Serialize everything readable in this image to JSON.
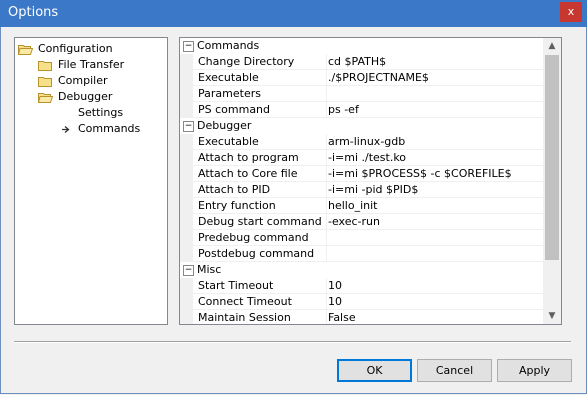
{
  "window": {
    "title": "Options",
    "close_label": "x"
  },
  "tree": {
    "items": [
      {
        "label": "Configuration",
        "icon": "folder-open-icon"
      },
      {
        "label": "File Transfer",
        "icon": "folder-icon"
      },
      {
        "label": "Compiler",
        "icon": "folder-icon"
      },
      {
        "label": "Debugger",
        "icon": "folder-open-icon"
      },
      {
        "label": "Settings",
        "icon": ""
      },
      {
        "label": "Commands",
        "icon": "arrow-right-icon"
      }
    ]
  },
  "properties": {
    "categories": [
      {
        "label": "Commands",
        "collapse_glyph": "−",
        "props": [
          {
            "name": "Change Directory",
            "value": "cd $PATH$"
          },
          {
            "name": "Executable",
            "value": "./$PROJECTNAME$"
          },
          {
            "name": "Parameters",
            "value": ""
          },
          {
            "name": "PS command",
            "value": "ps -ef"
          }
        ]
      },
      {
        "label": "Debugger",
        "collapse_glyph": "−",
        "props": [
          {
            "name": "Executable",
            "value": "arm-linux-gdb"
          },
          {
            "name": "Attach to program",
            "value": "-i=mi ./test.ko"
          },
          {
            "name": "Attach to Core file",
            "value": "-i=mi $PROCESS$ -c $COREFILE$"
          },
          {
            "name": "Attach to PID",
            "value": "-i=mi -pid $PID$"
          },
          {
            "name": "Entry function",
            "value": "hello_init",
            "editing": true
          },
          {
            "name": "Debug start command",
            "value": "-exec-run"
          },
          {
            "name": "Predebug command",
            "value": ""
          },
          {
            "name": "Postdebug command",
            "value": ""
          }
        ]
      },
      {
        "label": "Misc",
        "collapse_glyph": "−",
        "props": [
          {
            "name": "Start Timeout",
            "value": "10"
          },
          {
            "name": "Connect Timeout",
            "value": "10"
          },
          {
            "name": "Maintain Session",
            "value": "False"
          }
        ]
      }
    ],
    "scroll_up_glyph": "▲",
    "scroll_down_glyph": "▼"
  },
  "buttons": {
    "ok": "OK",
    "cancel": "Cancel",
    "apply": "Apply"
  },
  "colors": {
    "titlebar": "#3c78c8",
    "close": "#c7372f",
    "accent": "#0078d7"
  }
}
